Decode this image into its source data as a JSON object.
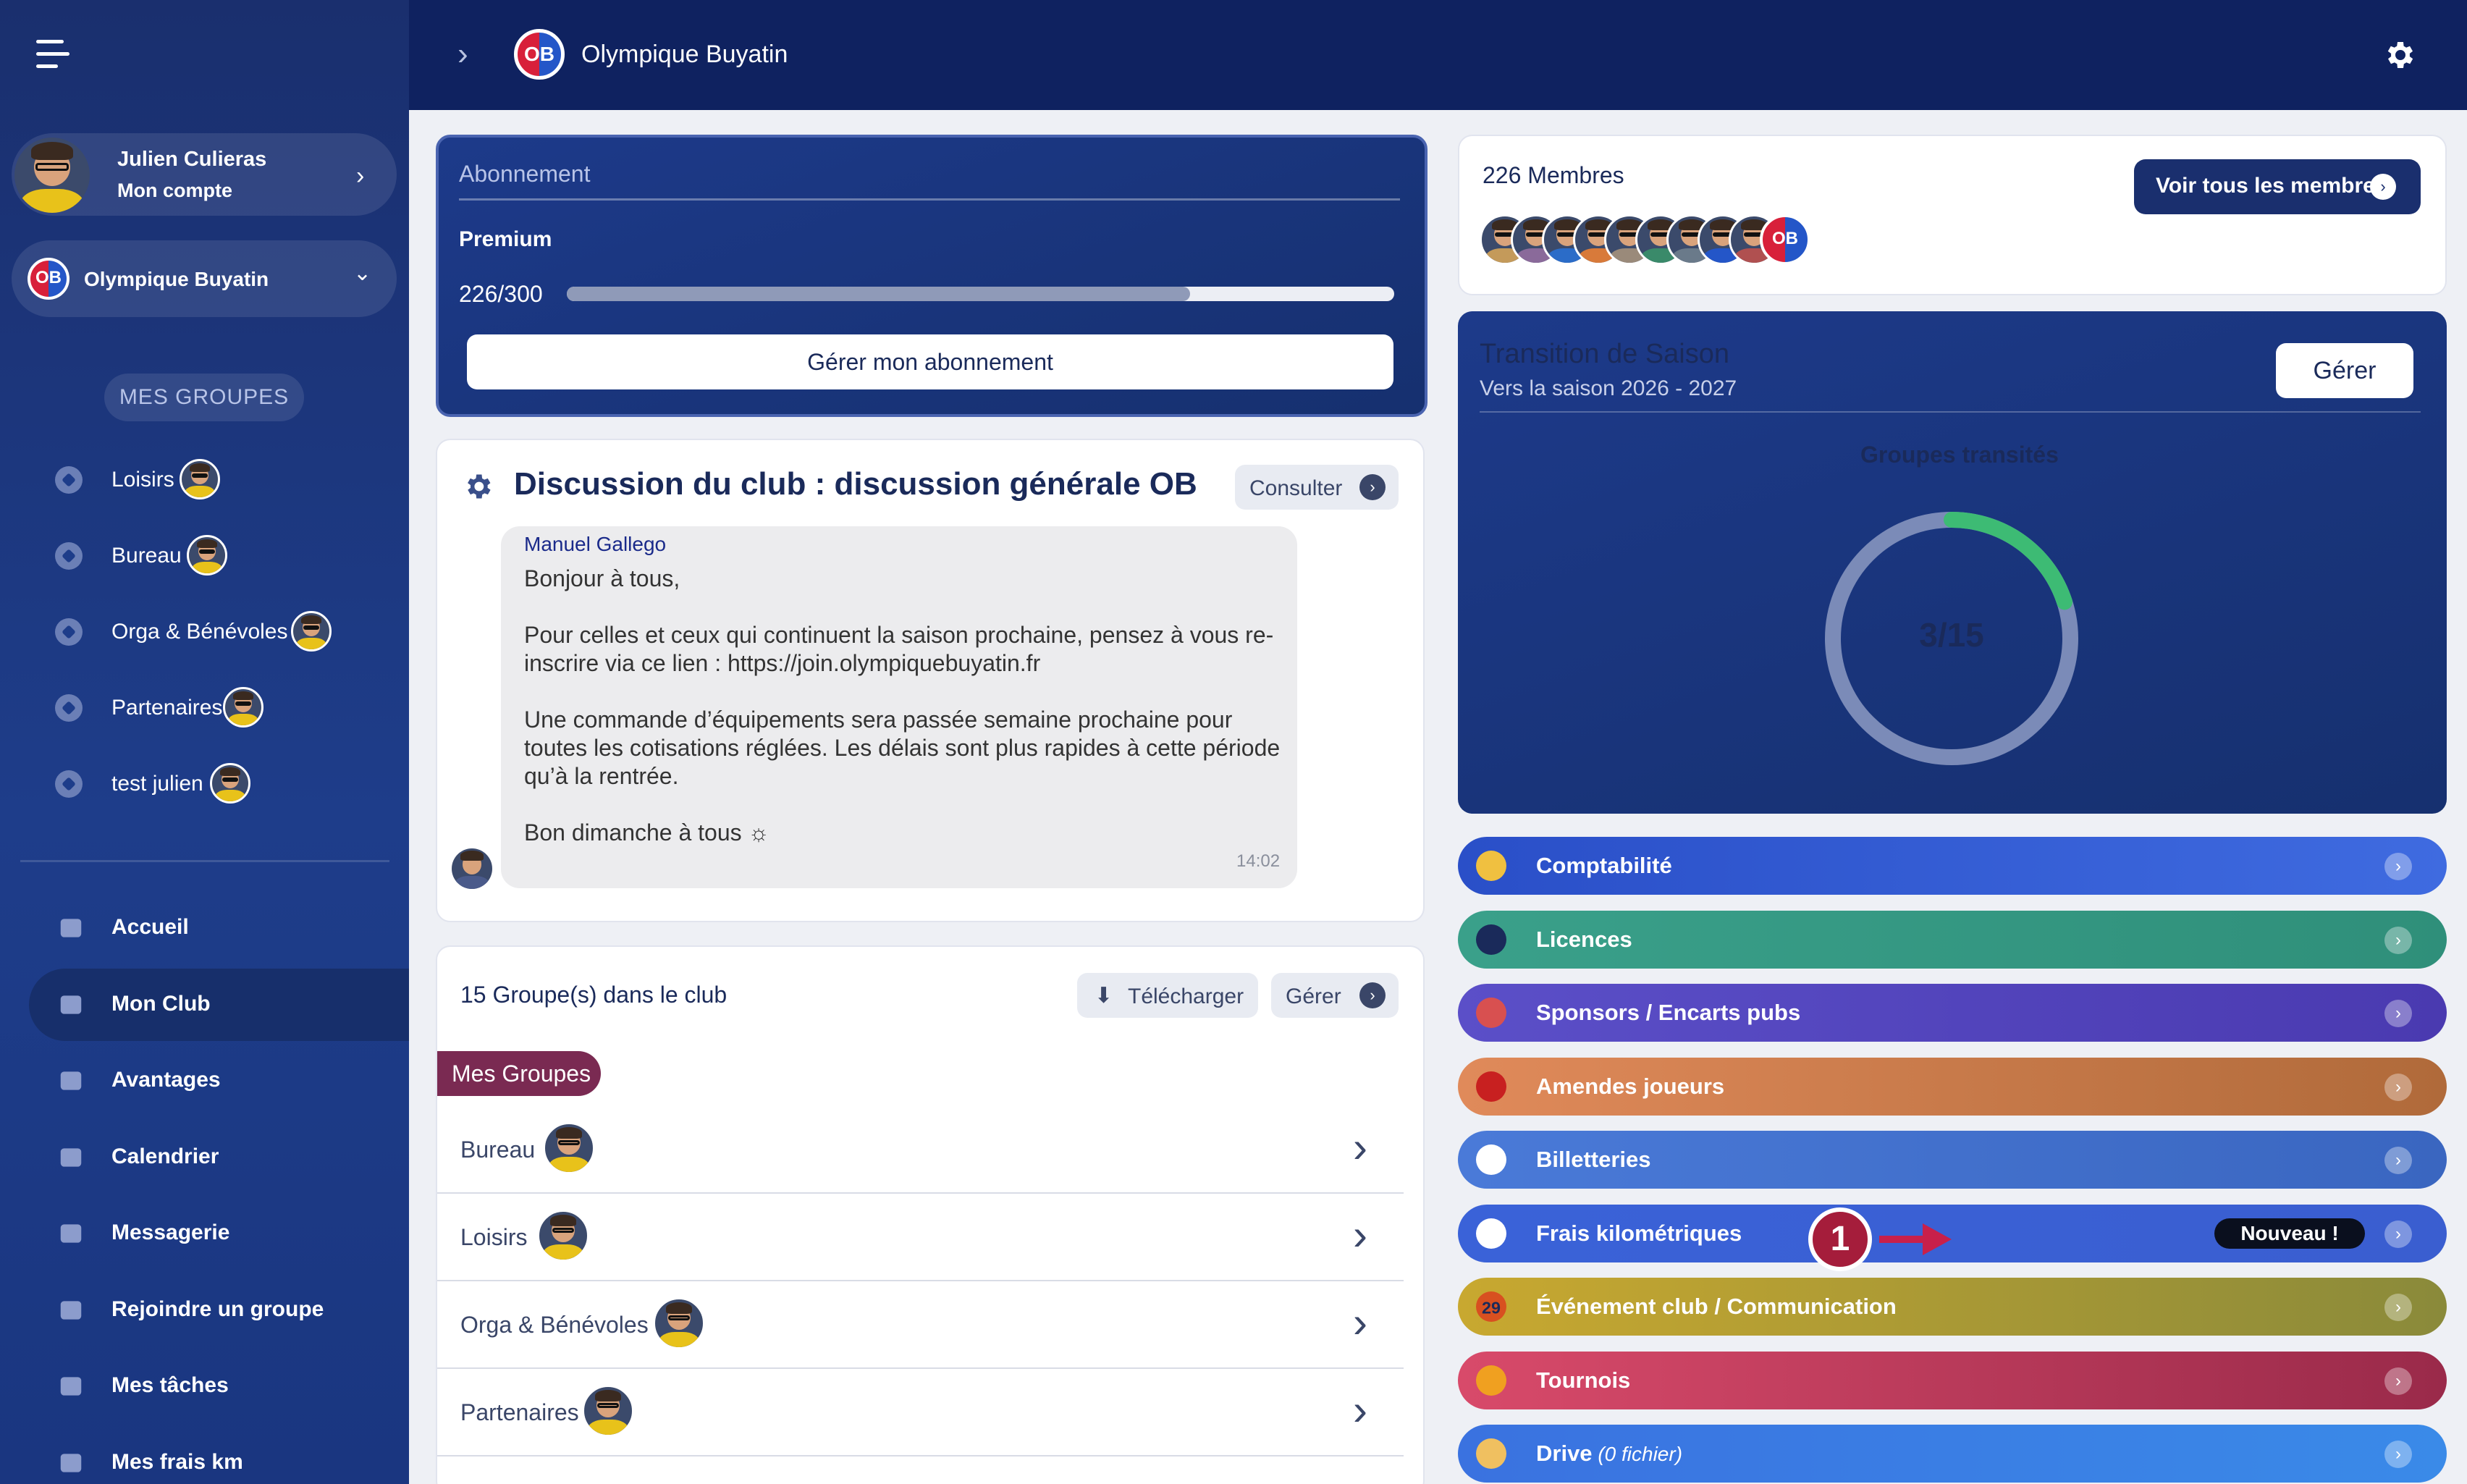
{
  "sidebar": {
    "account": {
      "name": "Julien Culieras",
      "subtitle": "Mon compte"
    },
    "club": {
      "logo_text": "OB",
      "name": "Olympique Buyatin"
    },
    "groups_header": "MES GROUPES",
    "groups": [
      {
        "label": "Loisirs"
      },
      {
        "label": "Bureau"
      },
      {
        "label": "Orga & Bénévoles"
      },
      {
        "label": "Partenaires"
      },
      {
        "label": "test julien"
      }
    ],
    "nav": [
      {
        "label": "Accueil",
        "icon": "home-icon"
      },
      {
        "label": "Mon Club",
        "icon": "star-icon"
      },
      {
        "label": "Avantages",
        "icon": "gift-icon"
      },
      {
        "label": "Calendrier",
        "icon": "calendar-icon"
      },
      {
        "label": "Messagerie",
        "icon": "chat-icon"
      },
      {
        "label": "Rejoindre un groupe",
        "icon": "add-user-icon"
      },
      {
        "label": "Mes tâches",
        "icon": "user-check-icon"
      },
      {
        "label": "Mes frais km",
        "icon": "car-icon"
      }
    ]
  },
  "topbar": {
    "logo_text": "OB",
    "title": "Olympique Buyatin"
  },
  "subscription": {
    "title": "Abonnement",
    "plan": "Premium",
    "count": "226/300",
    "progress_fraction": 0.7533,
    "manage_label": "Gérer mon abonnement"
  },
  "discussion": {
    "title": "Discussion du club : discussion générale OB",
    "consult_label": "Consulter",
    "message": {
      "author": "Manuel Gallego",
      "lines": [
        "Bonjour à tous,",
        "Pour celles et ceux qui continuent la saison prochaine, pensez à vous re-inscrire via ce lien : https://join.olympiquebuyatin.fr",
        "Une commande d’équipements sera passée semaine prochaine pour toutes les cotisations réglées. Les délais sont plus rapides à cette période qu’à la rentrée.",
        "Bon dimanche à tous ☼"
      ],
      "time": "14:02"
    }
  },
  "groups_card": {
    "title": "15 Groupe(s) dans le club",
    "download_label": "Télécharger",
    "manage_label": "Gérer",
    "tag": "Mes Groupes",
    "rows": [
      {
        "name": "Bureau"
      },
      {
        "name": "Loisirs"
      },
      {
        "name": "Orga & Bénévoles"
      },
      {
        "name": "Partenaires"
      }
    ]
  },
  "members": {
    "title": "226 Membres",
    "view_all_label": "Voir tous les membres",
    "last_avatar_text": "OB"
  },
  "transition": {
    "title": "Transition de Saison",
    "subtitle": "Vers la saison 2026 - 2027",
    "manage_label": "Gérer",
    "chart_title": "Groupes transités",
    "value_text": "3/15",
    "fraction": 0.2,
    "track_color": "#7b8bb8",
    "fill_color": "#3dbb74"
  },
  "features": [
    {
      "label": "Comptabilité",
      "icon": "coins-icon",
      "extra": "",
      "badge": ""
    },
    {
      "label": "Licences",
      "icon": "team-icon",
      "extra": "",
      "badge": ""
    },
    {
      "label": "Sponsors / Encarts pubs",
      "icon": "handshake-icon",
      "extra": "",
      "badge": ""
    },
    {
      "label": "Amendes joueurs",
      "icon": "whistle-card-icon",
      "extra": "",
      "badge": ""
    },
    {
      "label": "Billetteries",
      "icon": "ticket-icon",
      "extra": "",
      "badge": ""
    },
    {
      "label": "Frais kilométriques",
      "icon": "car-icon",
      "extra": "",
      "badge": "Nouveau !"
    },
    {
      "label": "Événement club / Communication",
      "icon": "calendar-29-icon",
      "icon_text": "29",
      "extra": "",
      "badge": ""
    },
    {
      "label": "Tournois",
      "icon": "trophy-icon",
      "extra": "",
      "badge": ""
    },
    {
      "label": "Drive",
      "icon": "folder-icon",
      "extra": " (0 fichier)",
      "badge": ""
    }
  ],
  "annotation": {
    "step_number": "1"
  },
  "colors": {
    "sidebar": "#1e3d8a",
    "topbar": "#0f2260",
    "accent_dark": "#1a2f6e",
    "group_tag": "#7a2a52",
    "step_marker": "#a51d3b"
  }
}
